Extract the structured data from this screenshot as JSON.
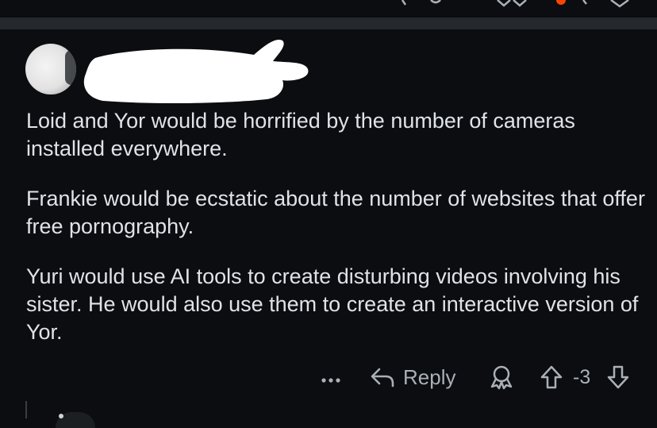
{
  "comment": {
    "paragraphs": [
      "Loid and Yor would be horrified by the number of cameras installed everywhere.",
      "Frankie would be ecstatic about the number of websites that offer free pornography.",
      "Yuri would use AI tools to create disturbing videos involving his sister. He would also use them to create an interactive version of Yor."
    ]
  },
  "actions": {
    "reply_label": "Reply",
    "score": "-3",
    "more_icon": "more-dots-icon",
    "reply_icon": "reply-arrow-icon",
    "award_icon": "award-icon",
    "upvote_icon": "upvote-arrow-icon",
    "downvote_icon": "downvote-arrow-icon"
  },
  "colors": {
    "background": "#0b0d10",
    "separator": "#25292d",
    "text": "#dfe3e7",
    "muted": "#aab0b6",
    "accent": "#ff4500"
  }
}
